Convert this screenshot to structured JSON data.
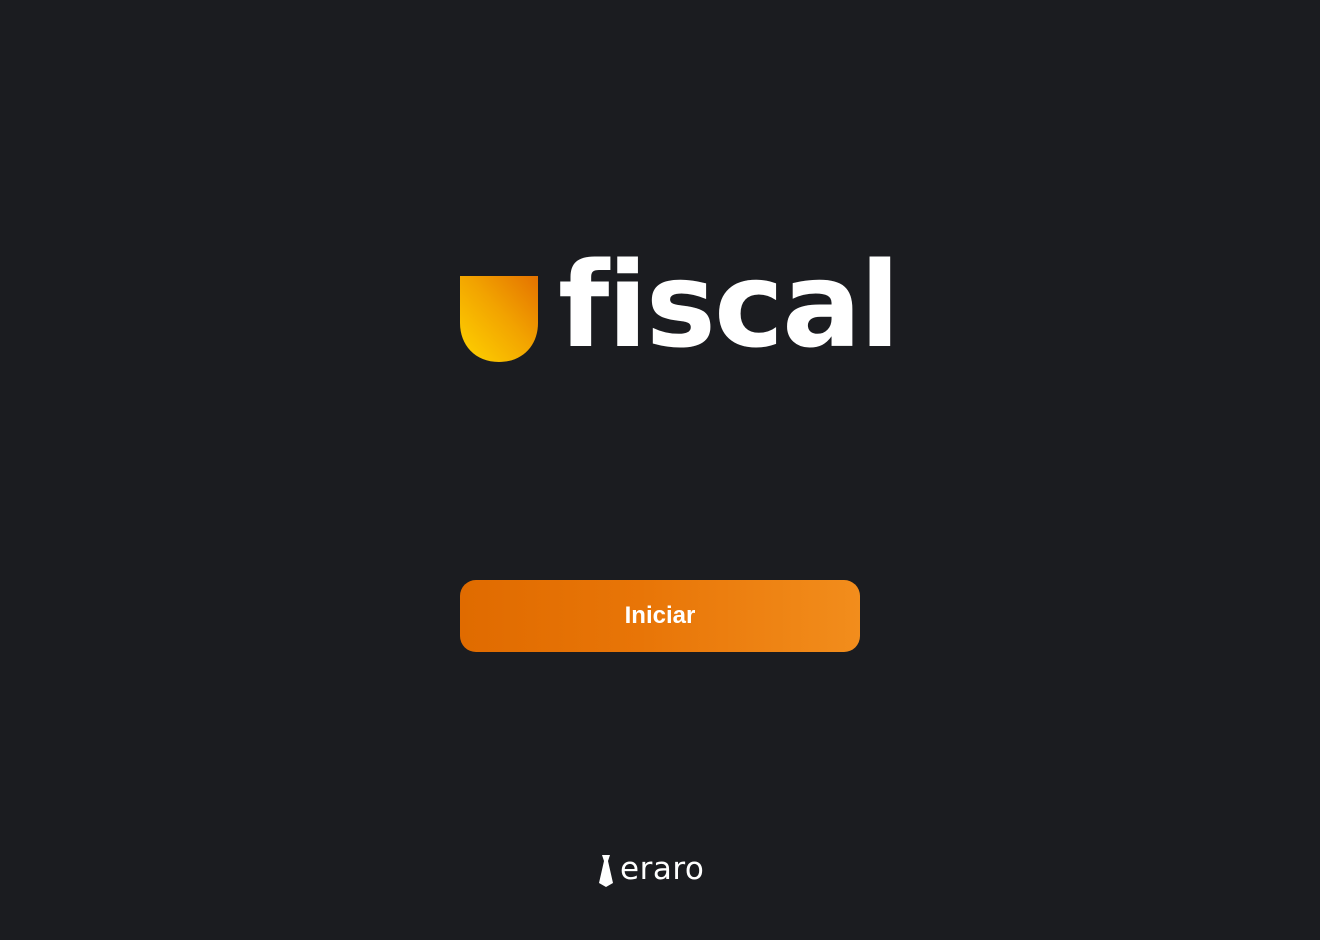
{
  "app": {
    "name": "fiscal",
    "accent_color": "#e87507",
    "background_color": "#1b1c20"
  },
  "logo": {
    "icon": "shield-icon",
    "word": "fiscal",
    "gradient": [
      "#f7c600",
      "#e37b00"
    ]
  },
  "actions": {
    "start_label": "Iniciar"
  },
  "footer": {
    "icon": "tie-icon",
    "brand": "eraro"
  }
}
